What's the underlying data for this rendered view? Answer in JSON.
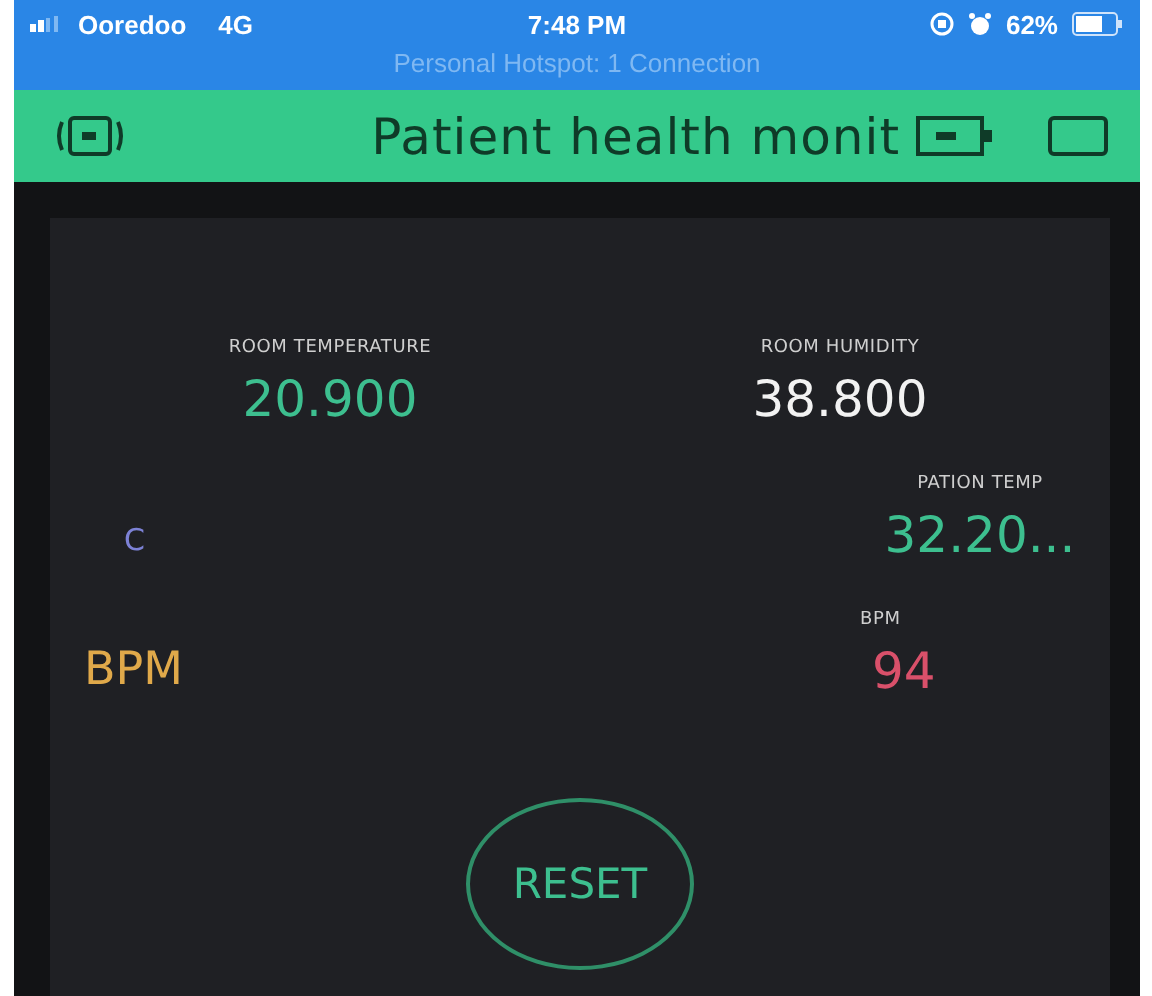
{
  "status_bar": {
    "carrier": "Ooredoo",
    "network": "4G",
    "time": "7:48 PM",
    "battery": "62%",
    "hotspot": "Personal Hotspot: 1 Connection"
  },
  "header": {
    "title": "Patient health monit"
  },
  "widgets": [
    {
      "kind": "display",
      "label": "ROOM TEMPERATURE",
      "value": "20.900",
      "color": "#3dbf8f"
    },
    {
      "kind": "display",
      "label": "ROOM HUMIDITY",
      "value": "38.800",
      "color": "#f2f2f2"
    },
    {
      "kind": "text",
      "text": "C",
      "color": "#7d82d6"
    },
    {
      "kind": "display",
      "label": "PATION TEMP",
      "value": "32.20...",
      "color": "#3dbf8f"
    },
    {
      "kind": "text",
      "text": "BPM",
      "color": "#e0a94a"
    },
    {
      "kind": "display",
      "label": "BPM",
      "value": "94",
      "color": "#d9506a"
    },
    {
      "kind": "button",
      "label": "RESET",
      "color": "#3dbf8f"
    }
  ]
}
